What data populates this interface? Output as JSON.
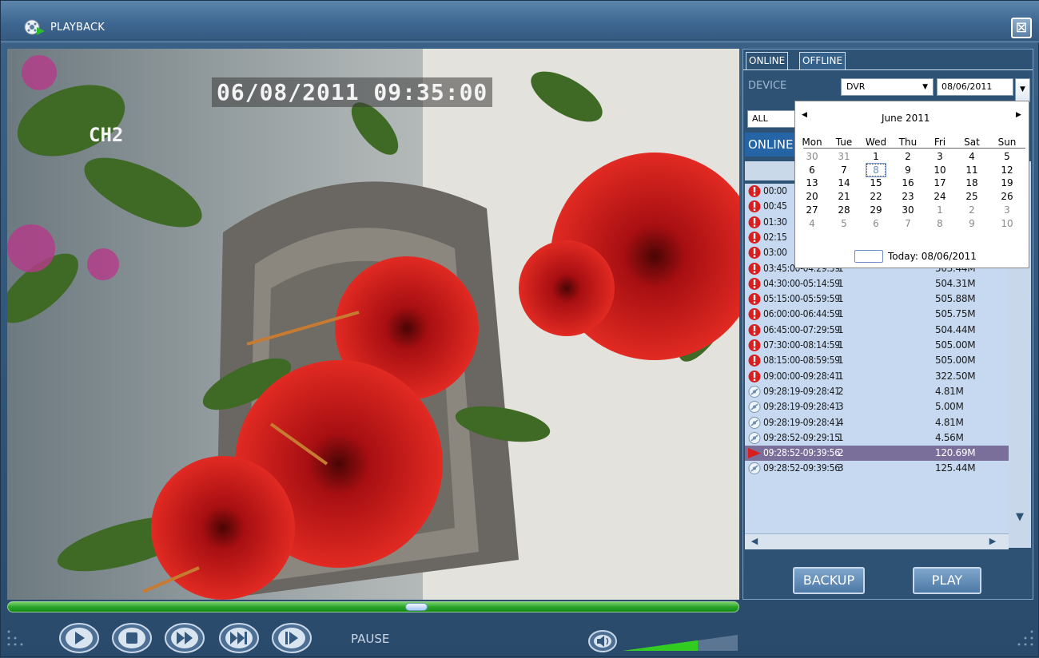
{
  "window": {
    "title": "PLAYBACK",
    "close_glyph": "⊠"
  },
  "video": {
    "timestamp": "06/08/2011 09:35:00",
    "channel": "CH2"
  },
  "panel": {
    "tabs": [
      {
        "label": "ONLINE"
      },
      {
        "label": "OFFLINE"
      }
    ],
    "device_label": "DEVICE",
    "device_value": "DVR",
    "date_value": "08/06/2011",
    "filter_value": "ALL",
    "online_header": "ONLINE",
    "backup_label": "BACKUP",
    "play_label": "PLAY"
  },
  "calendar": {
    "month_label": "June 2011",
    "weekdays": [
      "Mon",
      "Tue",
      "Wed",
      "Thu",
      "Fri",
      "Sat",
      "Sun"
    ],
    "weeks": [
      [
        "30",
        "31",
        "1",
        "2",
        "3",
        "4",
        "5"
      ],
      [
        "6",
        "7",
        "8",
        "9",
        "10",
        "11",
        "12"
      ],
      [
        "13",
        "14",
        "15",
        "16",
        "17",
        "18",
        "19"
      ],
      [
        "20",
        "21",
        "22",
        "23",
        "24",
        "25",
        "26"
      ],
      [
        "27",
        "28",
        "29",
        "30",
        "1",
        "2",
        "3"
      ],
      [
        "4",
        "5",
        "6",
        "7",
        "8",
        "9",
        "10"
      ]
    ],
    "today_label": "Today: 08/06/2011"
  },
  "records": [
    {
      "time": "00:00",
      "ch": "",
      "size": "",
      "icon": "alarm-icon"
    },
    {
      "time": "00:45",
      "ch": "",
      "size": "",
      "icon": "alarm-icon"
    },
    {
      "time": "01:30",
      "ch": "",
      "size": "",
      "icon": "alarm-icon"
    },
    {
      "time": "02:15",
      "ch": "",
      "size": "",
      "icon": "alarm-icon"
    },
    {
      "time": "03:00",
      "ch": "",
      "size": "",
      "icon": "alarm-icon"
    },
    {
      "time": "03:45:00-04:29:59",
      "ch": "1",
      "size": "503.44M",
      "icon": "alarm-icon"
    },
    {
      "time": "04:30:00-05:14:59",
      "ch": "1",
      "size": "504.31M",
      "icon": "alarm-icon"
    },
    {
      "time": "05:15:00-05:59:59",
      "ch": "1",
      "size": "505.88M",
      "icon": "alarm-icon"
    },
    {
      "time": "06:00:00-06:44:59",
      "ch": "1",
      "size": "505.75M",
      "icon": "alarm-icon"
    },
    {
      "time": "06:45:00-07:29:59",
      "ch": "1",
      "size": "504.44M",
      "icon": "alarm-icon"
    },
    {
      "time": "07:30:00-08:14:59",
      "ch": "1",
      "size": "505.00M",
      "icon": "alarm-icon"
    },
    {
      "time": "08:15:00-08:59:59",
      "ch": "1",
      "size": "505.00M",
      "icon": "alarm-icon"
    },
    {
      "time": "09:00:00-09:28:41",
      "ch": "1",
      "size": "322.50M",
      "icon": "alarm-icon"
    },
    {
      "time": "09:28:19-09:28:41",
      "ch": "2",
      "size": "4.81M",
      "icon": "record-icon"
    },
    {
      "time": "09:28:19-09:28:41",
      "ch": "3",
      "size": "5.00M",
      "icon": "record-icon"
    },
    {
      "time": "09:28:19-09:28:41",
      "ch": "4",
      "size": "4.81M",
      "icon": "record-icon"
    },
    {
      "time": "09:28:52-09:29:15",
      "ch": "1",
      "size": "4.56M",
      "icon": "record-icon"
    },
    {
      "time": "09:28:52-09:39:56",
      "ch": "2",
      "size": "120.69M",
      "icon": "playing-icon"
    },
    {
      "time": "09:28:52-09:39:56",
      "ch": "3",
      "size": "125.44M",
      "icon": "record-icon"
    }
  ],
  "playback": {
    "progress": 0.56,
    "status": "PAUSE",
    "volume": 0.65
  },
  "colors": {
    "progress": "#2aa52a",
    "selected_row": "#7a6f9a",
    "alarm": "#d81e1e",
    "panel_bg": "#2e5274"
  }
}
